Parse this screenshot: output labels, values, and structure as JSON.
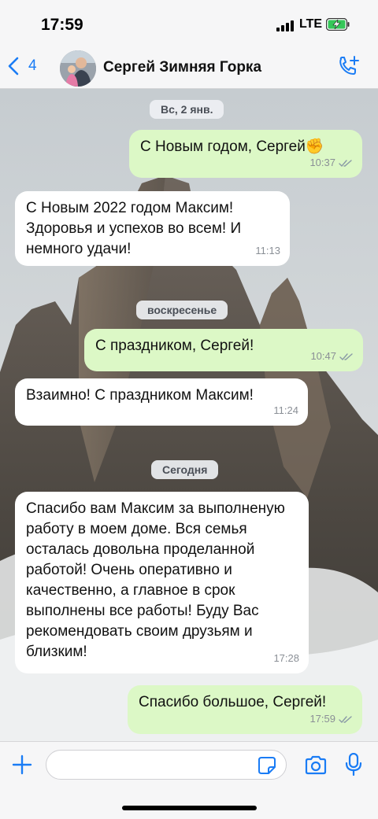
{
  "status_bar": {
    "time": "17:59",
    "network": "LTE"
  },
  "header": {
    "back_count": "4",
    "contact_name": "Сергей Зимняя Горка"
  },
  "date_separators": [
    "Вс, 2 янв.",
    "воскресенье",
    "Сегодня"
  ],
  "messages": [
    {
      "direction": "out",
      "text": "С Новым годом, Сергей✊",
      "time": "10:37",
      "read": true
    },
    {
      "direction": "in",
      "text": "С Новым 2022 годом Максим! Здоровья и успехов во всем! И немного удачи!",
      "time": "11:13"
    },
    {
      "direction": "out",
      "text": "С праздником, Сергей!",
      "time": "10:47",
      "read": true
    },
    {
      "direction": "in",
      "text": "Взаимно! С праздником Максим!",
      "time": "11:24"
    },
    {
      "direction": "in",
      "text": "Спасибо вам Максим за выполненую работу в моем доме. Вся семья осталась довольна проделанной работой! Очень оперативно и качественно, а главное в срок выполнены все работы! Буду Вас рекомендовать своим друзьям и близким!",
      "time": "17:28"
    },
    {
      "direction": "out",
      "text": "Спасибо большое, Сергей!",
      "time": "17:59",
      "read": true
    }
  ],
  "composer": {
    "placeholder": ""
  },
  "icons": {
    "back": "chevron-left-icon",
    "call": "phone-plus-icon",
    "attach": "plus-icon",
    "sticker": "sticker-icon",
    "camera": "camera-icon",
    "mic": "microphone-icon"
  },
  "colors": {
    "accent": "#1a7cf5",
    "outgoing_bubble": "#dcf8c6",
    "incoming_bubble": "#ffffff"
  }
}
